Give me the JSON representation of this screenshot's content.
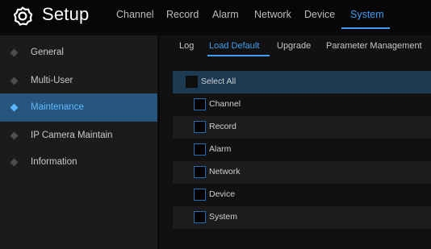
{
  "header": {
    "title": "Setup",
    "icon": "gear-icon",
    "tabs": [
      {
        "label": "Channel",
        "active": false
      },
      {
        "label": "Record",
        "active": false
      },
      {
        "label": "Alarm",
        "active": false
      },
      {
        "label": "Network",
        "active": false
      },
      {
        "label": "Device",
        "active": false
      },
      {
        "label": "System",
        "active": true
      }
    ]
  },
  "sidebar": {
    "items": [
      {
        "label": "General",
        "active": false
      },
      {
        "label": "Multi-User",
        "active": false
      },
      {
        "label": "Maintenance",
        "active": true
      },
      {
        "label": "IP Camera Maintain",
        "active": false
      },
      {
        "label": "Information",
        "active": false
      }
    ]
  },
  "subtabs": [
    {
      "label": "Log",
      "active": false
    },
    {
      "label": "Load Default",
      "active": true
    },
    {
      "label": "Upgrade",
      "active": false
    },
    {
      "label": "Parameter Management",
      "active": false
    }
  ],
  "options": {
    "select_all": {
      "label": "Select All",
      "checked": false
    },
    "items": [
      {
        "label": "Channel",
        "checked": false
      },
      {
        "label": "Record",
        "checked": false
      },
      {
        "label": "Alarm",
        "checked": false
      },
      {
        "label": "Network",
        "checked": false
      },
      {
        "label": "Device",
        "checked": false
      },
      {
        "label": "System",
        "checked": false
      }
    ]
  },
  "colors": {
    "accent": "#3f9df2",
    "active_sidebar_bg": "#26567d",
    "select_all_bg": "#1d3a52"
  }
}
